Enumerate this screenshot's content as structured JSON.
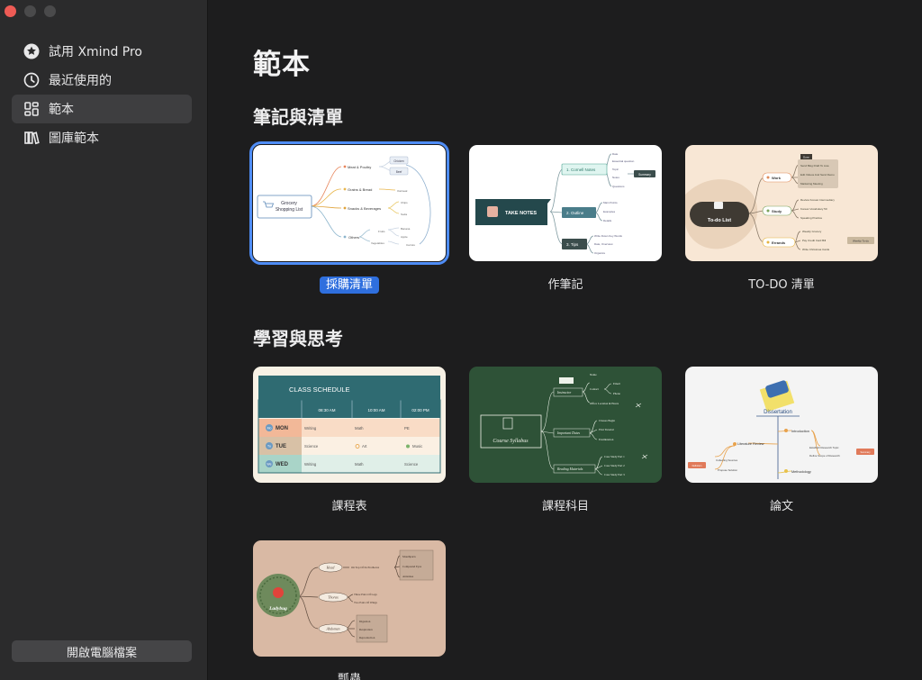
{
  "sidebar": {
    "items": [
      {
        "label": "試用 Xmind Pro",
        "icon": "star-icon",
        "active": false
      },
      {
        "label": "最近使用的",
        "icon": "clock-icon",
        "active": false
      },
      {
        "label": "範本",
        "icon": "grid-icon",
        "active": true
      },
      {
        "label": "圖庫範本",
        "icon": "library-icon",
        "active": false
      }
    ],
    "open_button": "開啟電腦檔案"
  },
  "main": {
    "title": "範本",
    "sections": [
      {
        "title": "筆記與清單",
        "cards": [
          {
            "label": "採購清單",
            "selected": true
          },
          {
            "label": "作筆記"
          },
          {
            "label": "TO-DO 清單"
          }
        ]
      },
      {
        "title": "學習與思考",
        "cards": [
          {
            "label": "課程表"
          },
          {
            "label": "課程科目"
          },
          {
            "label": "論文"
          },
          {
            "label": "瓢蟲"
          }
        ]
      }
    ]
  },
  "thumbs": {
    "grocery": {
      "center": [
        "Grocery",
        "Shopping List"
      ],
      "branches": [
        "Meat & Poultry",
        "Grains & Bread",
        "Snacks & Beverages",
        "Others"
      ],
      "leaves": [
        "Chicken",
        "Beef",
        "Oatmeal",
        "Chips",
        "Soda",
        "Fruits",
        "Banana",
        "Apple",
        "Vegetables",
        "Carrots"
      ]
    },
    "notes": {
      "center": "TAKE NOTES",
      "branches": [
        "1. Cornell Notes",
        "2. Outline",
        "3. Tips"
      ],
      "leaves": [
        "Date",
        "Essential question",
        "Topic",
        "Notes",
        "Questions",
        "Summary",
        "Main Points",
        "Examples",
        "Details",
        "Write Down Key Words",
        "Date, Overview",
        "Organize"
      ]
    },
    "todo": {
      "center": "To-do List",
      "branches": [
        "Work",
        "Study",
        "Errands"
      ],
      "leaves": [
        "Done",
        "Send Blog Draft To Lisa",
        "Edit Videos And Send Demo",
        "Marketing Meeting",
        "Review Korean Intermediary",
        "Korean Vocabulary 50",
        "Speaking Practice",
        "Weekly Grocery",
        "Pay Credit Card Bill",
        "Write Christmas Cards",
        "Weekly To-do"
      ]
    },
    "schedule": {
      "title": "CLASS SCHEDULE",
      "times": [
        "08:30 AM",
        "10:00 AM",
        "02:00 PM"
      ],
      "rows": [
        {
          "abbr": "Mo",
          "day": "MON",
          "cells": [
            "Writing",
            "Math",
            "PE"
          ]
        },
        {
          "abbr": "Tu",
          "day": "TUE",
          "cells": [
            "Science",
            "Art",
            "Music"
          ]
        },
        {
          "abbr": "We",
          "day": "WED",
          "cells": [
            "Writing",
            "Math",
            "Science"
          ]
        }
      ]
    },
    "syllabus": {
      "center": "Course Syllabus",
      "branches": [
        "Instructor",
        "Important Dates",
        "Reading Materials"
      ],
      "leaves": [
        "Contact",
        "Name",
        "Email",
        "Phone",
        "Office Location & Hours",
        "Classes Begin",
        "First Tutorial",
        "Examination",
        "Case Study Part 1",
        "Case Study Part 2",
        "Case Study Part 3"
      ]
    },
    "dissertation": {
      "center": "Dissertation",
      "branches": [
        "Literature Review",
        "Introduction",
        "Methodology"
      ],
      "leaves": [
        "Collecting Sources",
        "Propose Solution",
        "Establish Research Topic",
        "Define Scope of Research",
        "Summary",
        "Definition"
      ]
    },
    "ladybug": {
      "center": "Ladybug",
      "branches": [
        "Head",
        "Thorax",
        "Abdomen"
      ],
      "leaves": [
        "On Top Of Its Prothorax",
        "Mouthparts",
        "Compound Eyes",
        "Antennae",
        "Three Pairs Of Legs",
        "Two Pairs Of Wings",
        "Digestion",
        "Respiration",
        "Reproduction"
      ]
    }
  }
}
